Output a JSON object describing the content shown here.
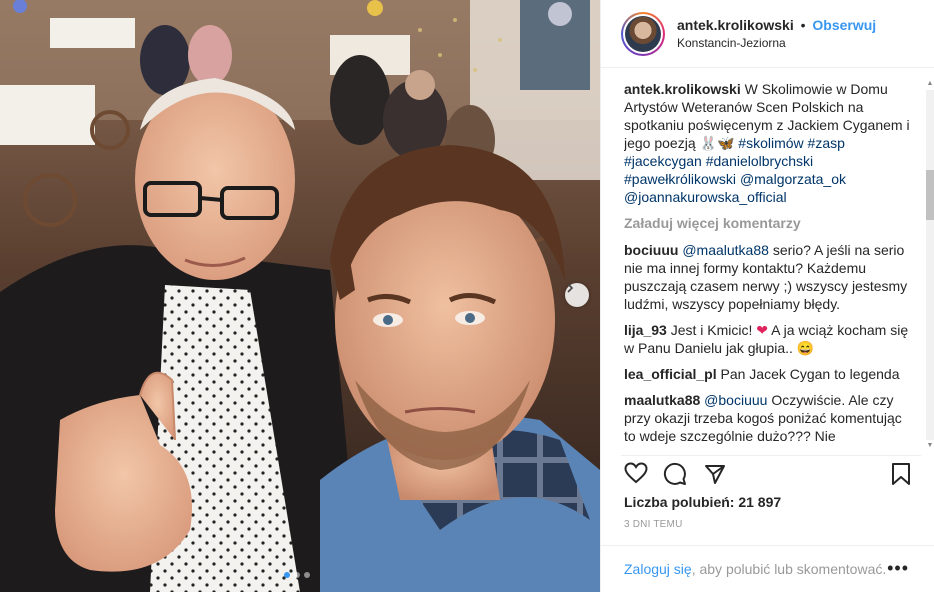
{
  "post": {
    "username": "antek.krolikowski",
    "separator": "•",
    "follow_label": "Obserwuj",
    "location": "Konstancin-Jeziorna"
  },
  "caption": {
    "username": "antek.krolikowski",
    "text": "W Skolimowie w Domu Artystów Weteranów Scen Polskich na spotkaniu poświęcenym z Jackiem Cyganem i jego poezją",
    "emoji": "🐰🦋",
    "tags": [
      "#skolimów",
      "#zasp",
      "#jacekcygan",
      "#danielolbrychski",
      "#pawełkrólikowski",
      "@malgorzata_ok",
      "@joannakurowska_official"
    ]
  },
  "load_more": "Załaduj więcej komentarzy",
  "comments": [
    {
      "user": "bociuuu",
      "mention": "@maalutka88",
      "text": "serio? A jeśli na serio nie ma innej formy kontaktu? Każdemu puszczają czasem nerwy ;) wszyscy jestesmy ludźmi, wszyscy popełniamy błędy."
    },
    {
      "user": "lija_93",
      "text_before": "Jest i Kmicic!",
      "heart": "❤",
      "text_after": "A ja wciąż kocham się w Panu Danielu jak głupia..",
      "emoji": "😄"
    },
    {
      "user": "lea_official_pl",
      "text": "Pan Jacek Cygan to legenda"
    },
    {
      "user": "maalutka88",
      "mention": "@bociuuu",
      "text": "Oczywiście. Ale czy przy okazji trzeba kogoś poniżać komentując to wdeje szczególnie dużo??? Nie"
    }
  ],
  "likes_label": "Liczba polubień: 21 897",
  "time_label": "3 DNI TEMU",
  "login": {
    "link": "Zaloguj się",
    "text": ", aby polubić lub skomentować.",
    "more": "•••"
  },
  "icons": {
    "like": "heart-icon",
    "comment": "comment-icon",
    "share": "share-icon",
    "save": "bookmark-icon",
    "next": "chevron-right-icon"
  },
  "colors": {
    "link_blue": "#3897f0",
    "mention": "#003569",
    "muted": "#999999"
  }
}
